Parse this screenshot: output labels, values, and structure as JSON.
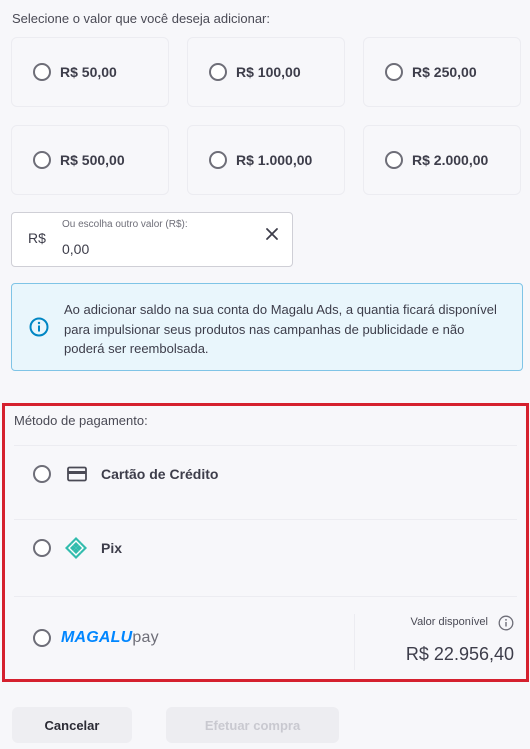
{
  "amounts": {
    "title": "Selecione o valor que você deseja adicionar:",
    "options": [
      {
        "label": "R$ 50,00"
      },
      {
        "label": "R$ 100,00"
      },
      {
        "label": "R$ 250,00"
      },
      {
        "label": "R$ 500,00"
      },
      {
        "label": "R$ 1.000,00"
      },
      {
        "label": "R$ 2.000,00"
      }
    ]
  },
  "other_value": {
    "prefix": "R$",
    "label": "Ou escolha outro valor (R$):",
    "value": "0,00"
  },
  "info": {
    "text": "Ao adicionar saldo na sua conta do Magalu Ads, a quantia ficará disponível para impulsionar seus produtos nas campanhas de publicidade e não poderá ser reembolsada."
  },
  "payment": {
    "title": "Método de pagamento:",
    "methods": [
      {
        "label": "Cartão de Crédito",
        "icon": "credit-card-icon"
      },
      {
        "label": "Pix",
        "icon": "pix-icon"
      },
      {
        "label": "",
        "logo_text": "MAGALUpay",
        "icon": "magalupay-logo"
      }
    ],
    "available_label": "Valor disponível",
    "available_value": "R$ 22.956,40"
  },
  "actions": {
    "cancel_label": "Cancelar",
    "buy_label": "Efetuar compra"
  },
  "colors": {
    "accent_red": "#d5202e",
    "info_blue": "#0086c3",
    "magalu_blue": "#0086ff",
    "pix_teal": "#32bcad"
  }
}
